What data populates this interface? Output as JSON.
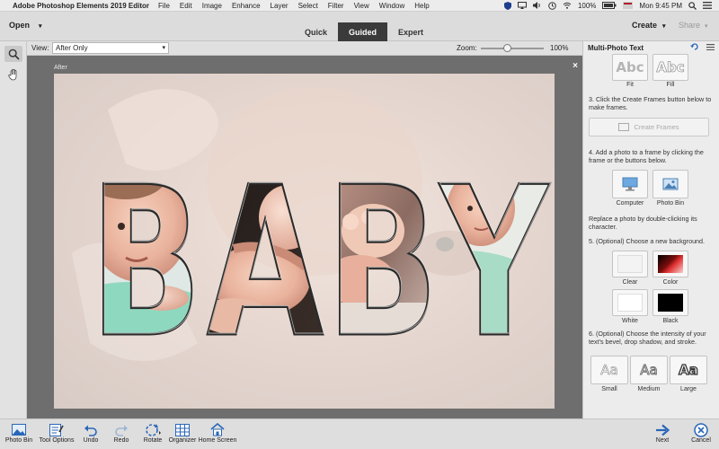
{
  "menubar": {
    "app_name": "Adobe Photoshop Elements 2019 Editor",
    "items": [
      "File",
      "Edit",
      "Image",
      "Enhance",
      "Layer",
      "Select",
      "Filter",
      "View",
      "Window",
      "Help"
    ],
    "battery": "100%",
    "clock": "Mon 9:45 PM"
  },
  "toolbar": {
    "open_label": "Open",
    "tabs": [
      {
        "label": "Quick",
        "active": false
      },
      {
        "label": "Guided",
        "active": true
      },
      {
        "label": "Expert",
        "active": false
      }
    ],
    "create_label": "Create",
    "share_label": "Share"
  },
  "options": {
    "view_label": "View:",
    "view_value": "After Only",
    "zoom_label": "Zoom:",
    "zoom_value": "100%",
    "zoom_level": 100
  },
  "canvas": {
    "after_label": "After",
    "close_glyph": "×",
    "word": "BABY"
  },
  "panel": {
    "title": "Multi-Photo Text",
    "fit_label": "Fit",
    "fill_label": "Fill",
    "sample_letters": "Abc",
    "step3": "3. Click the Create Frames button below to make frames.",
    "create_frames_label": "Create Frames",
    "step4": "4. Add a photo to a frame by clicking the frame or the buttons below.",
    "computer_label": "Computer",
    "photobin_label": "Photo Bin",
    "replace_text": "Replace a photo by double-clicking its character.",
    "step5": "5. (Optional) Choose a new background.",
    "clear_label": "Clear",
    "color_label": "Color",
    "white_label": "White",
    "black_label": "Black",
    "step6": "6. (Optional) Choose the intensity of your text's bevel, drop shadow, and stroke.",
    "intensity_sample": "Aa",
    "small_label": "Small",
    "medium_label": "Medium",
    "large_label": "Large"
  },
  "bottom": {
    "photobin": "Photo Bin",
    "tooloptions": "Tool Options",
    "undo": "Undo",
    "redo": "Redo",
    "rotate": "Rotate",
    "organizer": "Organizer",
    "homescreen": "Home Screen",
    "next": "Next",
    "cancel": "Cancel"
  },
  "colors": {
    "accent": "#2a66b8",
    "active_tab": "#3b3b3b",
    "canvas_bg": "#6e6e6e",
    "cancel_red": "#cc2a2a"
  }
}
